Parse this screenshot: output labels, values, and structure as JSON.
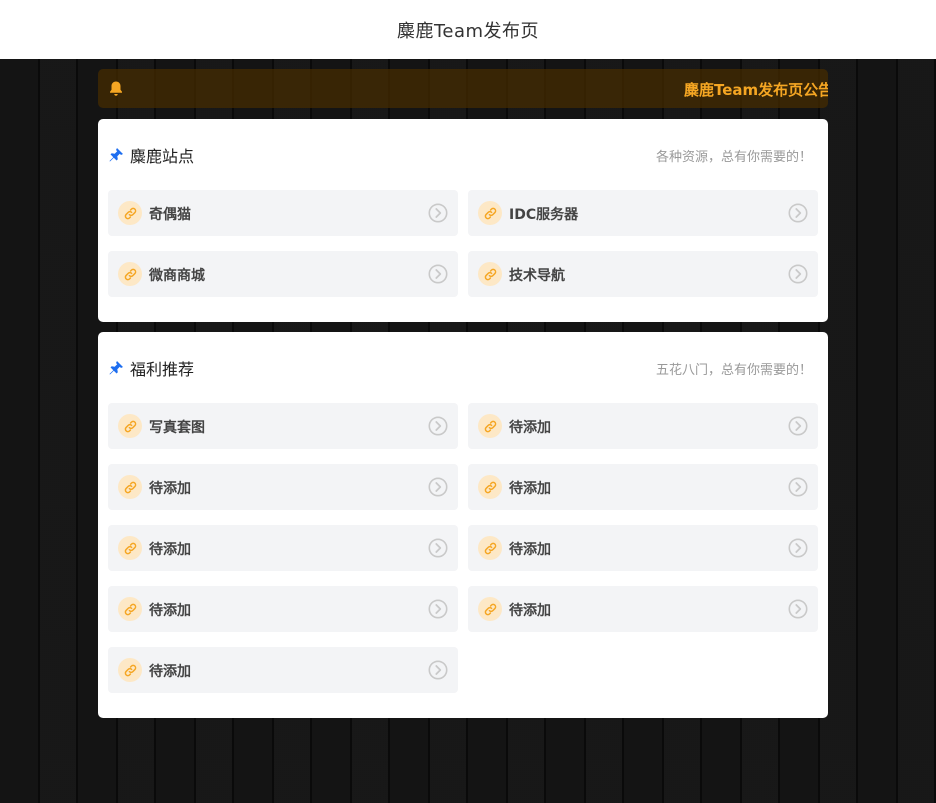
{
  "header": {
    "title": "麋鹿Team发布页"
  },
  "notice": {
    "icon": "bell-icon",
    "text": "麋鹿Team发布页公告",
    "color": "#f5a623"
  },
  "sections": [
    {
      "title": "麋鹿站点",
      "subtitle": "各种资源，总有你需要的！",
      "items": [
        {
          "label": "奇偶猫"
        },
        {
          "label": "IDC服务器"
        },
        {
          "label": "微商商城"
        },
        {
          "label": "技术导航"
        }
      ]
    },
    {
      "title": "福利推荐",
      "subtitle": "五花八门，总有你需要的！",
      "items": [
        {
          "label": "写真套图"
        },
        {
          "label": "待添加"
        },
        {
          "label": "待添加"
        },
        {
          "label": "待添加"
        },
        {
          "label": "待添加"
        },
        {
          "label": "待添加"
        },
        {
          "label": "待添加"
        },
        {
          "label": "待添加"
        },
        {
          "label": "待添加"
        }
      ]
    }
  ],
  "colors": {
    "accent": "#f5a623",
    "pin": "#1e6ef0",
    "item_bg": "#f3f4f6"
  }
}
